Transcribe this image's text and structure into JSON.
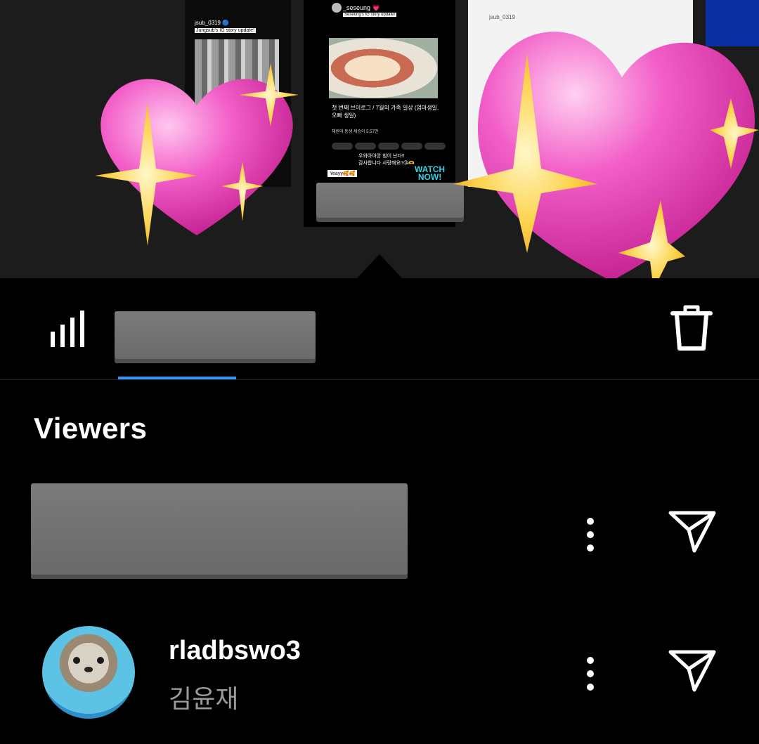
{
  "story_preview": {
    "left_thumb": {
      "username": "jsub_0319 🔵",
      "caption": "Jungsub's IG story update!"
    },
    "center_thumb": {
      "username": "_seseung 💗",
      "caption": "Seseung's IG story update!",
      "video_title": "첫 번째 브이로그 / 7월의 가족 일상 (엄마생일, 오빠 생일)",
      "channel": "채원이 동생 세승이 5.57만",
      "comment": "우와아아앙 힘이 난다!!\n감사합니다 사랑해요!!😘🫶",
      "yeay_label": "Yeayy🥰🥰",
      "watch_label_1": "WATCH",
      "watch_label_2": "NOW!"
    },
    "right_thumb": {
      "username": "jsub_0319"
    }
  },
  "toolbar": {
    "stats_icon": "bar-chart-icon",
    "delete_icon": "trash-icon",
    "active_tab_color": "#3797f0"
  },
  "viewers": {
    "heading": "Viewers",
    "list": [
      {
        "username": "",
        "fullname": "",
        "redacted": true
      },
      {
        "username": "rladbswo3",
        "fullname": "김윤재",
        "avatar": "otter-avatar"
      }
    ]
  },
  "stickers": [
    "sparkling-heart-icon",
    "sparkling-heart-icon"
  ]
}
